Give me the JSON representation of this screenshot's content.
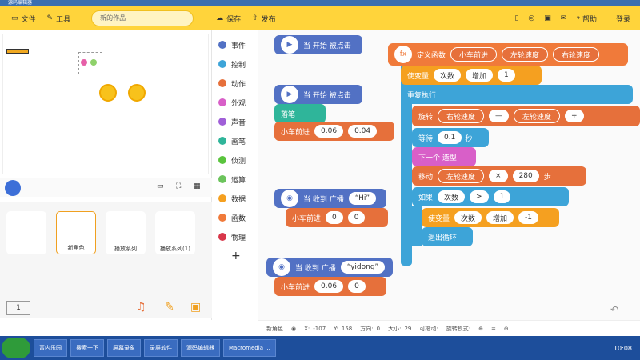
{
  "window": {
    "title": "源码编辑器"
  },
  "menu": {
    "file": "文件",
    "tools": "工具",
    "project_name": "新的作品",
    "save": "保存",
    "publish": "发布",
    "help": "帮助",
    "login": "登录"
  },
  "sprites": [
    {
      "label": "新角色"
    },
    {
      "label": "播放系列"
    },
    {
      "label": "播放系列(1)"
    }
  ],
  "page_indicator": "1",
  "categories": [
    "事件",
    "控制",
    "动作",
    "外观",
    "声音",
    "画笔",
    "侦测",
    "运算",
    "数据",
    "函数",
    "物理"
  ],
  "blocks": {
    "when_start": "当 开始 被点击",
    "pen_down": "落笔",
    "car_forward": "小车前进",
    "val_006": "0.06",
    "val_004": "0.04",
    "when_msg": "当 收到 广播",
    "msg_hi": "“Hi”",
    "val_0": "0",
    "msg_yidong": "“yidong”",
    "define": "定义函数",
    "fn_name": "小车前进",
    "left_speed": "左轮速度",
    "right_speed": "右轮速度",
    "set_var": "使变量",
    "var_count": "次数",
    "increase": "增加",
    "val_1": "1",
    "repeat": "重复执行",
    "rotate": "旋转",
    "minus": "—",
    "divide": "÷",
    "wait": "等待",
    "val_01": "0.1",
    "seconds": "秒",
    "next_costume": "下一个 造型",
    "move": "移动",
    "times": "×",
    "val_280": "280",
    "steps": "步",
    "if": "如果",
    "gt": ">",
    "val_neg1": "-1",
    "break": "退出循环"
  },
  "status": {
    "sprite": "新角色",
    "x_label": "X:",
    "x": "-107",
    "y_label": "Y:",
    "y": "158",
    "dir_label": "方向:",
    "dir": "0",
    "size_label": "大小:",
    "size": "29",
    "drag_label": "可拖动:",
    "rot_label": "旋转模式:"
  },
  "taskbar": {
    "items": [
      "富内乐园",
      "搜索一下",
      "屏幕录象",
      "录屏软件",
      "源码编辑器",
      "Macromedia ..."
    ],
    "time": "10:08"
  }
}
